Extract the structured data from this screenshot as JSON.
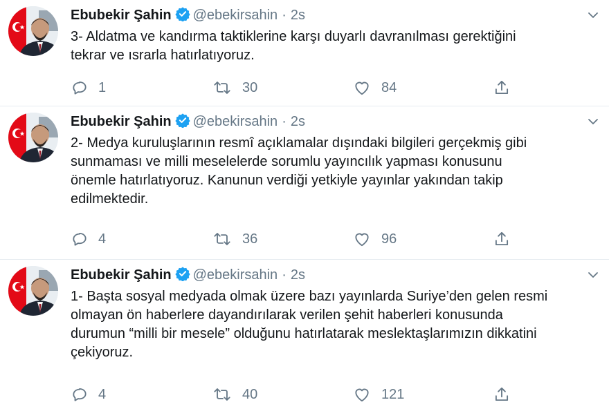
{
  "tweets": [
    {
      "name": "Ebubekir Şahin",
      "handle": "@ebekirsahin",
      "separator": "·",
      "time": "2s",
      "text": "3- Aldatma ve kandırma taktiklerine karşı duyarlı davranılması gerektiğini\ntekrar ve ısrarla hatırlatıyoruz.",
      "replies": "1",
      "retweets": "30",
      "likes": "84"
    },
    {
      "name": "Ebubekir Şahin",
      "handle": "@ebekirsahin",
      "separator": "·",
      "time": "2s",
      "text": "2- Medya kuruluşlarının resmî açıklamalar dışındaki bilgileri gerçekmiş gibi\nsunmaması ve milli meselelerde sorumlu yayıncılık yapması konusunu\nönemle hatırlatıyoruz. Kanunun verdiği yetkiyle yayınlar yakından takip\nedilmektedir.",
      "replies": "4",
      "retweets": "36",
      "likes": "96"
    },
    {
      "name": "Ebubekir Şahin",
      "handle": "@ebekirsahin",
      "separator": "·",
      "time": "2s",
      "text": "1- Başta sosyal medyada olmak üzere bazı yayınlarda Suriye’den gelen resmi\nolmayan ön haberlere dayandırılarak verilen şehit haberleri konusunda\ndurumun “milli bir mesele” olduğunu hatırlatarak meslektaşlarımızın dikkatini\nçekiyoruz.",
      "replies": "4",
      "retweets": "40",
      "likes": "121"
    }
  ],
  "icons": {
    "verified": "verified-badge-icon",
    "caret": "chevron-down-icon",
    "reply": "reply-icon",
    "retweet": "retweet-icon",
    "like": "heart-icon",
    "share": "share-icon"
  },
  "colors": {
    "text": "#14171a",
    "secondary": "#657786",
    "verified": "#1da1f2",
    "divider": "#e6ecf0",
    "flag_red": "#e30a17"
  }
}
